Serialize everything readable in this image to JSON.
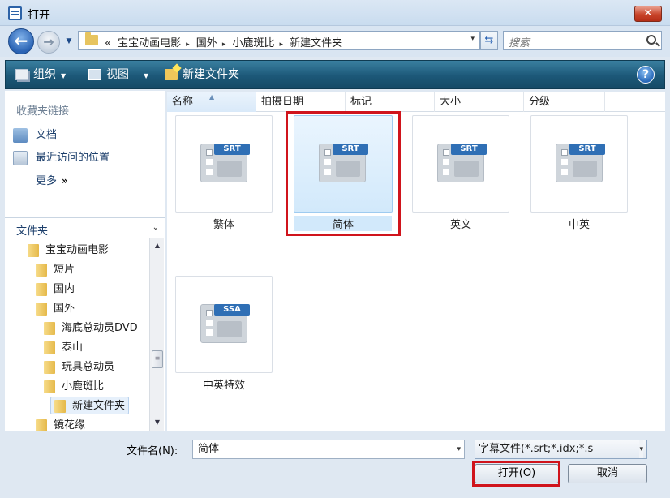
{
  "window": {
    "title": "打开",
    "close_label": "✕"
  },
  "nav": {
    "back": "←",
    "forward": "→",
    "dropdown": "▼"
  },
  "address": {
    "prefix": "«",
    "crumbs": [
      "宝宝动画电影",
      "国外",
      "小鹿斑比",
      "新建文件夹"
    ],
    "separator": "▸",
    "dropdown": "▾"
  },
  "refresh_glyph": "⇆",
  "search": {
    "placeholder": "搜索"
  },
  "toolbar": {
    "organize": "组织",
    "views": "视图",
    "new_folder": "新建文件夹",
    "caret": "▼",
    "help": "?"
  },
  "sidebar": {
    "favorites_heading": "收藏夹链接",
    "favorites": [
      "文档",
      "最近访问的位置"
    ],
    "more": "更多",
    "more_glyph": "»",
    "folders_label": "文件夹",
    "folders_toggle": "⌄",
    "tree": [
      {
        "label": "宝宝动画电影",
        "level": 1
      },
      {
        "label": "短片",
        "level": 2
      },
      {
        "label": "国内",
        "level": 2
      },
      {
        "label": "国外",
        "level": 2
      },
      {
        "label": "海底总动员DVD",
        "level": 3
      },
      {
        "label": "泰山",
        "level": 3
      },
      {
        "label": "玩具总动员",
        "level": 3
      },
      {
        "label": "小鹿斑比",
        "level": 3
      },
      {
        "label": "新建文件夹",
        "level": 4,
        "selected": true
      },
      {
        "label": "镜花缘",
        "level": 2
      }
    ],
    "scroll_up": "▲",
    "scroll_down": "▼",
    "scroll_grip": "≡"
  },
  "columns": [
    "名称",
    "拍摄日期",
    "标记",
    "大小",
    "分级"
  ],
  "sort_glyph": "▲",
  "files": [
    {
      "name": "繁体",
      "tag": "SRT"
    },
    {
      "name": "简体",
      "tag": "SRT",
      "selected": true
    },
    {
      "name": "英文",
      "tag": "SRT"
    },
    {
      "name": "中英",
      "tag": "SRT"
    },
    {
      "name": "中英特效",
      "tag": "SSA"
    }
  ],
  "footer": {
    "filename_label": "文件名(N):",
    "filename_value": "简体",
    "filter_value": "字幕文件(*.srt;*.idx;*.s",
    "open_label": "打开(O)",
    "cancel_label": "取消",
    "dropdown": "▾"
  },
  "colors": {
    "toolbar": "#1c5878",
    "highlight": "#d0141c",
    "selected_tile": "#d2e9fb"
  }
}
